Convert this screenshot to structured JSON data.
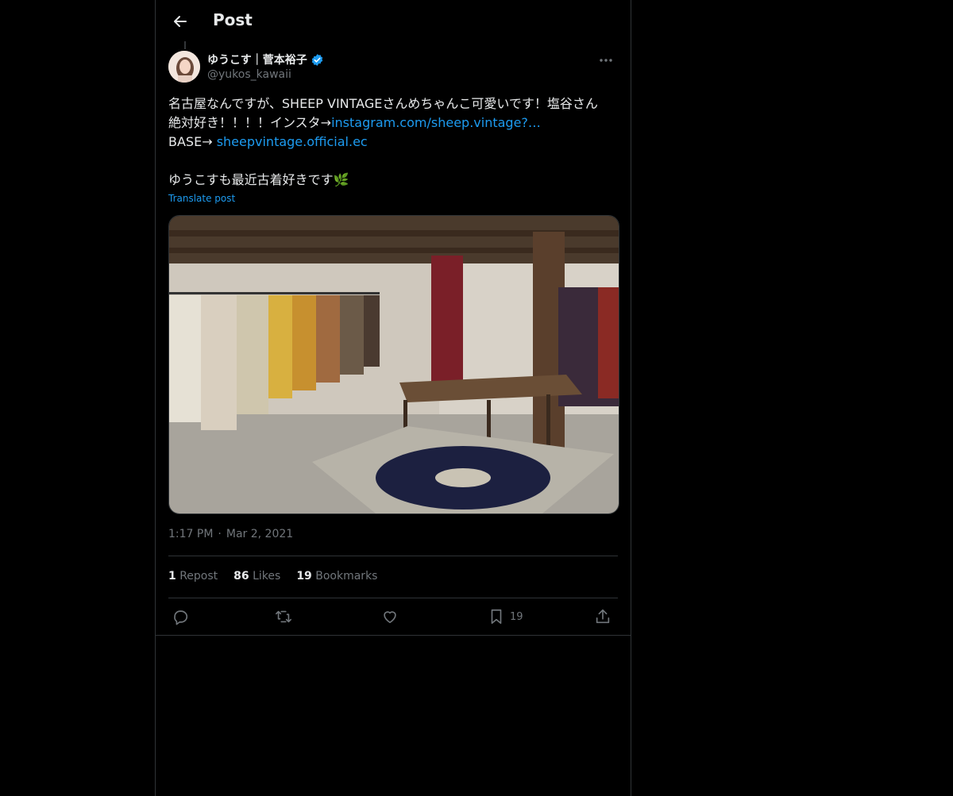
{
  "header": {
    "title": "Post",
    "back_icon": "arrow-left-icon"
  },
  "author": {
    "display_name": "ゆうこす｜菅本裕子",
    "handle": "@yukos_kawaii",
    "verified": true,
    "verified_color": "#1d9bf0"
  },
  "post": {
    "line1": "名古屋なんですが、SHEEP VINTAGEさんめちゃんこ可愛いです！塩谷さん",
    "line2_prefix": "絶対好き！！！！インスタ→",
    "line2_link": "instagram.com/sheep.vintage?…",
    "line3_prefix": "BASE→ ",
    "line3_link": "sheepvintage.official.ec",
    "line4": "ゆうこすも最近古着好きです🌿",
    "translate_label": "Translate post"
  },
  "meta": {
    "time": "1:17 PM",
    "separator": "·",
    "date": "Mar 2, 2021"
  },
  "stats": {
    "reposts_count": "1",
    "reposts_label": "Repost",
    "likes_count": "86",
    "likes_label": "Likes",
    "bookmarks_count": "19",
    "bookmarks_label": "Bookmarks"
  },
  "actions": {
    "bookmark_count": "19"
  },
  "colors": {
    "background": "#000000",
    "text": "#e7e9ea",
    "muted": "#71767b",
    "link": "#1d9bf0",
    "border": "#2f3336"
  }
}
